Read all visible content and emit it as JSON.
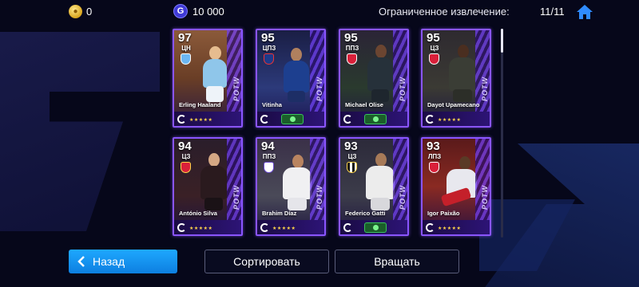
{
  "topbar": {
    "coins": "0",
    "coin_icon": "coin-icon",
    "gp_symbol": "G",
    "gp": "10 000",
    "limit_label": "Ограниченное извлечение:",
    "limit_count": "11/11",
    "home_icon": "home-icon"
  },
  "cards": [
    {
      "rating": "97",
      "position": "ЦН",
      "name": "Erling Haaland",
      "stars": "★★★★★",
      "has_pack": false
    },
    {
      "rating": "95",
      "position": "ЦПЗ",
      "name": "Vitinha",
      "stars": "★★★★★",
      "has_pack": true
    },
    {
      "rating": "95",
      "position": "ППЗ",
      "name": "Michael Olise",
      "stars": "★★★★★",
      "has_pack": true
    },
    {
      "rating": "95",
      "position": "ЦЗ",
      "name": "Dayot Upamecano",
      "stars": "★★★★★",
      "has_pack": false
    },
    {
      "rating": "94",
      "position": "ЦЗ",
      "name": "António Silva",
      "stars": "★★★★★",
      "has_pack": false
    },
    {
      "rating": "94",
      "position": "ППЗ",
      "name": "Brahim Díaz",
      "stars": "★★★★★",
      "has_pack": false
    },
    {
      "rating": "93",
      "position": "ЦЗ",
      "name": "Federico Gatti",
      "stars": "★★★★★",
      "has_pack": true
    },
    {
      "rating": "93",
      "position": "ЛПЗ",
      "name": "Igor Paixão",
      "stars": "★★★★★",
      "has_pack": false
    }
  ],
  "card_label": "POTW",
  "buttons": {
    "back": "Назад",
    "sort": "Сортировать",
    "rotate": "Вращать"
  },
  "colors": {
    "accent": "#1ea8ff",
    "card_border": "#8a55ff",
    "background": "#06071a"
  }
}
